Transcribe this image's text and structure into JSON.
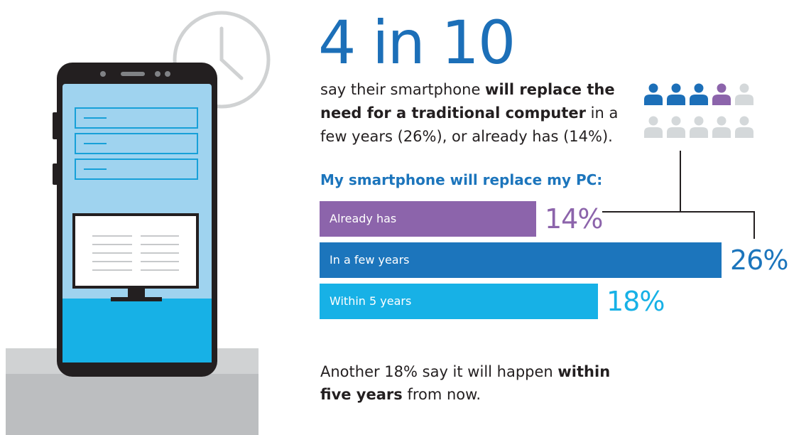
{
  "headline": "4 in 10",
  "intro": {
    "part1": "say their smartphone ",
    "bold": "will replace the need for a traditional computer",
    "part2": " in a few years (26%), or already has (14%)."
  },
  "people_icons": {
    "highlighted_blue": 3,
    "highlighted_purple": 1,
    "total": 10,
    "colors": {
      "blue": "#1c6fb8",
      "purple": "#8c64ab",
      "gray": "#d4d8da"
    }
  },
  "chart_data": {
    "type": "bar",
    "title": "My smartphone will replace my PC:",
    "orientation": "horizontal",
    "categories": [
      "Already has",
      "In a few years",
      "Within 5 years"
    ],
    "values": [
      14,
      26,
      18
    ],
    "value_labels": [
      "14%",
      "26%",
      "18%"
    ],
    "colors": [
      "#8c64ab",
      "#1c75bc",
      "#17b1e6"
    ],
    "value_colors": [
      "#8c64ab",
      "#1c75bc",
      "#17b1e6"
    ],
    "unit": "%",
    "xlim": [
      0,
      26
    ]
  },
  "footnote": {
    "part1": "Another 18% say it will happen ",
    "bold": "within five years",
    "part2": " from now."
  }
}
